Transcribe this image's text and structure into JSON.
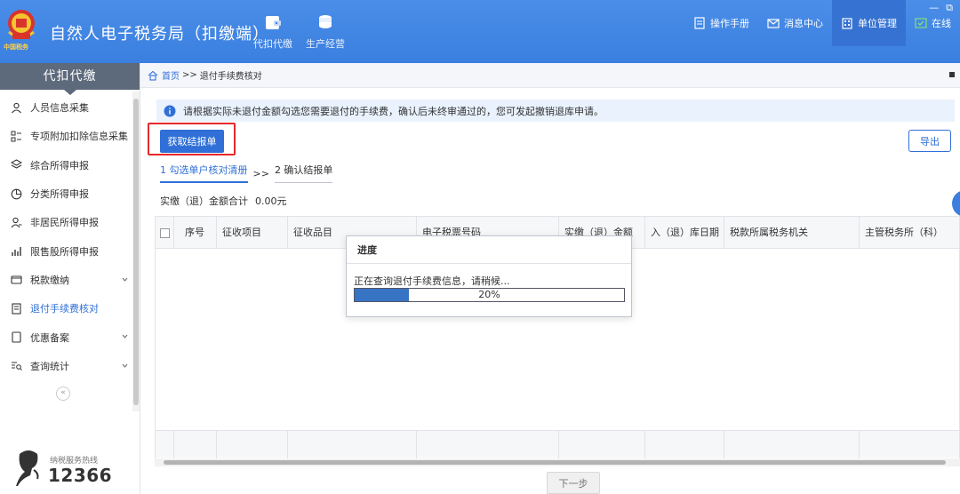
{
  "app": {
    "title": "自然人电子税务局（扣缴端）",
    "logo_text": "中国税务"
  },
  "top_nav": [
    {
      "label": "代扣代缴",
      "icon": "wallet-icon"
    },
    {
      "label": "生产经营",
      "icon": "coins-icon"
    }
  ],
  "top_actions": {
    "manual": "操作手册",
    "messages": "消息中心",
    "unit_management": "单位管理",
    "online": "在线"
  },
  "window_controls": {
    "minimize": "—",
    "restore": "⧉"
  },
  "sidebar": {
    "header": "代扣代缴",
    "items": [
      {
        "label": "人员信息采集",
        "icon": "person-icon",
        "expandable": false
      },
      {
        "label": "专项附加扣除信息采集",
        "icon": "grid-list-icon",
        "expandable": false
      },
      {
        "label": "综合所得申报",
        "icon": "layers-icon",
        "expandable": false
      },
      {
        "label": "分类所得申报",
        "icon": "clock-pie-icon",
        "expandable": false
      },
      {
        "label": "非居民所得申报",
        "icon": "person-alt-icon",
        "expandable": false
      },
      {
        "label": "限售股所得申报",
        "icon": "bar-chart-icon",
        "expandable": false
      },
      {
        "label": "税款缴纳",
        "icon": "folder-icon",
        "expandable": true
      },
      {
        "label": "退付手续费核对",
        "icon": "document-check-icon",
        "expandable": false,
        "active": true
      },
      {
        "label": "优惠备案",
        "icon": "file-icon",
        "expandable": true
      },
      {
        "label": "查询统计",
        "icon": "search-list-icon",
        "expandable": true
      }
    ],
    "collapse_label": "«",
    "hotline_label": "纳税服务热线",
    "hotline_number": "12366"
  },
  "breadcrumb": {
    "home": "首页",
    "separator": ">>",
    "current": "退付手续费核对"
  },
  "notice": "请根据实际未退付金额勾选您需要退付的手续费，确认后未终审通过的，您可发起撤销退库申请。",
  "buttons": {
    "fetch": "获取结报单",
    "export": "导出",
    "next": "下一步"
  },
  "steps": [
    {
      "label": "1 勾选单户核对清册",
      "active": true
    },
    {
      "label": "2 确认结报单",
      "active": false
    }
  ],
  "step_separator": ">>",
  "total": {
    "label": "实缴（退）金额合计",
    "value": "0.00元"
  },
  "table": {
    "columns": [
      "序号",
      "征收项目",
      "征收品目",
      "电子税票号码",
      "实缴（退）金额",
      "入（退）库日期",
      "税款所属税务机关",
      "主管税务所（科）"
    ]
  },
  "dialog": {
    "title": "进度",
    "message": "正在查询退付手续费信息，请稍候...",
    "progress_percent": 20,
    "progress_text": "20%"
  },
  "colors": {
    "header_bg": "#3b7fe0",
    "accent": "#2f6fd7",
    "highlight_frame": "#e5292b",
    "sidebar_head": "#5d6a7b"
  }
}
